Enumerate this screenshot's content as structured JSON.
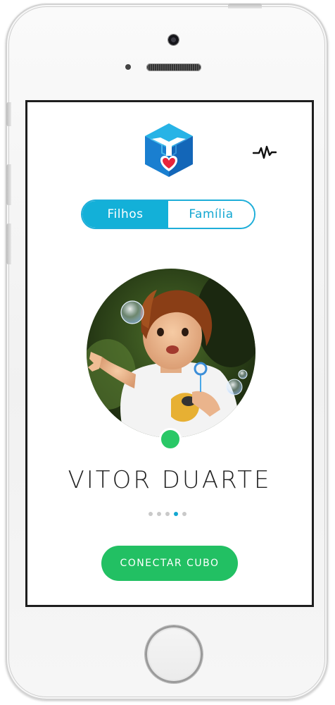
{
  "tabs": [
    {
      "label": "Filhos",
      "active": true
    },
    {
      "label": "Família",
      "active": false
    }
  ],
  "profile": {
    "name": "VITOR DUARTE",
    "status": "online",
    "status_color": "#29c866"
  },
  "pagination": {
    "total": 5,
    "current": 4
  },
  "actions": {
    "connect_label": "CONECTAR CUBO"
  },
  "colors": {
    "accent": "#13b0d8",
    "primary_button": "#22c063"
  },
  "icons": {
    "logo": "cube-heart-logo",
    "activity": "heartbeat-icon"
  }
}
